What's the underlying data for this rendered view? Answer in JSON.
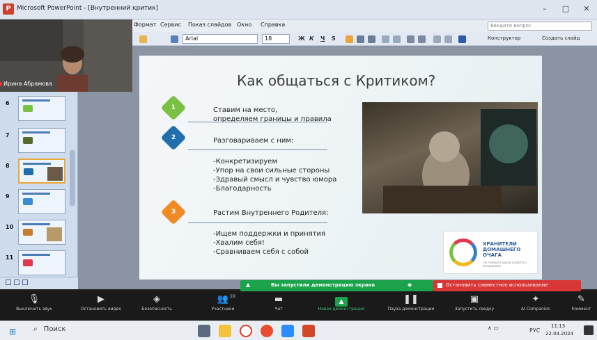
{
  "window": {
    "title": "Microsoft PowerPoint - [Внутренний критик]",
    "app_icon": "powerpoint-icon",
    "minimize": "–",
    "maximize": "□",
    "close": "✕"
  },
  "menu": {
    "items": [
      "Формат",
      "Сервис",
      "Показ слайдов",
      "Окно",
      "Справка"
    ],
    "help_placeholder": "Введите вопрос"
  },
  "toolbar": {
    "font": "Arial",
    "size": "18",
    "bold": "Ж",
    "italic": "К",
    "underline": "Ч",
    "shadow": "S",
    "designer": "Конструктор",
    "create": "Создать слайд"
  },
  "thumbnails": [
    {
      "num": "6"
    },
    {
      "num": "7"
    },
    {
      "num": "8",
      "selected": true
    },
    {
      "num": "9"
    },
    {
      "num": "10"
    },
    {
      "num": "11"
    }
  ],
  "webcam": {
    "name": "Ирина Абрамова",
    "mic_icon": "muted-mic-icon"
  },
  "slide": {
    "title": "Как общаться с Критиком?",
    "steps": [
      {
        "num": "1",
        "color": "#7ac143",
        "lines": [
          "Ставим на место,",
          "определяем границы и правила"
        ]
      },
      {
        "num": "2",
        "color": "#1f6fae",
        "lines": [
          "Разговариваем с ним:"
        ]
      },
      {
        "num": "3",
        "color": "#f08a24",
        "lines": [
          "Растим Внутреннего Родителя:"
        ]
      }
    ],
    "list_a": [
      "-Конкретизируем",
      "-Упор на свои сильные стороны",
      "-Здравый смысл и чувство юмора",
      "-Благодарность"
    ],
    "list_b": [
      "-Ищем поддержки и принятия",
      "-Хвалим себя!",
      "-Сравниваем себя с собой"
    ],
    "logo": {
      "text": "ХРАНИТЕЛИ ДОМАШНЕГО ОЧАГА",
      "sub": "Системный подход к работе с женщинами"
    }
  },
  "zoom": {
    "share_notice": "Вы запустили демонстрацию экрана",
    "stop_share": "Остановить совместное использование",
    "buttons": [
      {
        "label": "Выключить звук",
        "icon": "microphone-icon"
      },
      {
        "label": "Остановить видео",
        "icon": "video-icon"
      },
      {
        "label": "Безопасность",
        "icon": "shield-icon"
      },
      {
        "label": "Участники",
        "icon": "participants-icon",
        "count": "10"
      },
      {
        "label": "Чат",
        "icon": "chat-icon"
      },
      {
        "label": "Новая демонстрация",
        "icon": "share-icon",
        "green": true
      },
      {
        "label": "Пауза демонстрации",
        "icon": "pause-icon"
      },
      {
        "label": "Запустить сводку",
        "icon": "summary-icon"
      },
      {
        "label": "AI Companion",
        "icon": "sparkle-icon"
      },
      {
        "label": "Коммент",
        "icon": "annotate-icon"
      }
    ]
  },
  "taskbar": {
    "search": "Поиск",
    "lang": "РУС",
    "time": "11:13",
    "date": "22.04.2024"
  }
}
